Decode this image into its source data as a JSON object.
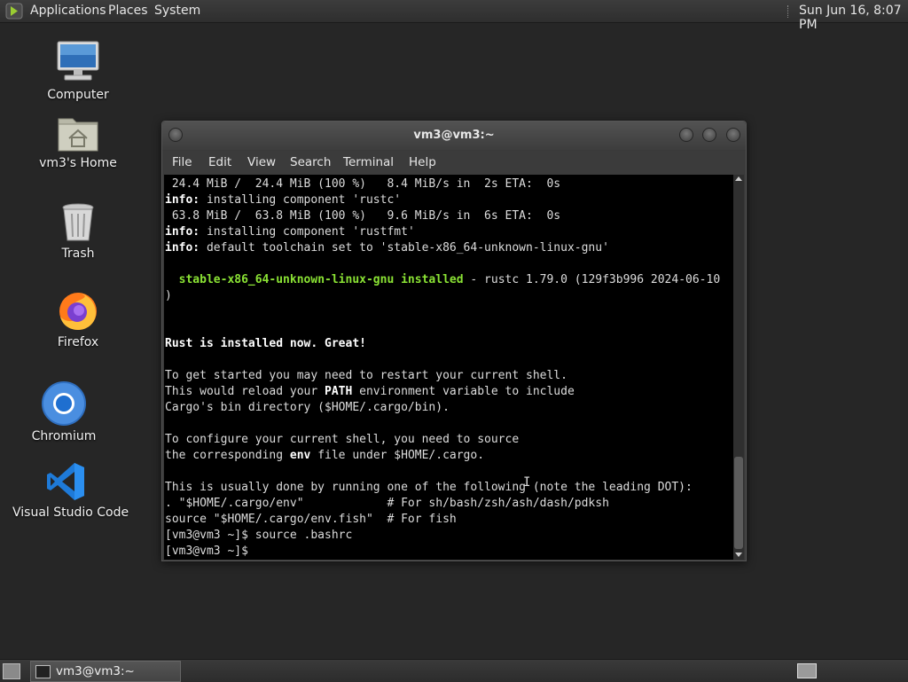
{
  "top_panel": {
    "menus": [
      "Applications",
      "Places",
      "System"
    ],
    "clock": "Sun Jun 16,  8:07 PM"
  },
  "desktop_icons": [
    {
      "label": "Computer",
      "icon": "computer-icon"
    },
    {
      "label": "vm3's Home",
      "icon": "home-folder-icon"
    },
    {
      "label": "Trash",
      "icon": "trash-icon"
    },
    {
      "label": "Firefox",
      "icon": "firefox-icon"
    },
    {
      "label": "Chromium",
      "icon": "chromium-icon"
    },
    {
      "label": "Visual Studio Code",
      "icon": "vscode-icon"
    }
  ],
  "terminal": {
    "title": "vm3@vm3:~",
    "menu": [
      "File",
      "Edit",
      "View",
      "Search",
      "Terminal",
      "Help"
    ],
    "lines": [
      [
        {
          "t": " 24.4 MiB /  24.4 MiB (100 %)   8.4 MiB/s in  2s ETA:  0s"
        }
      ],
      [
        {
          "t": "info:",
          "b": 1
        },
        {
          "t": " installing component 'rustc'"
        }
      ],
      [
        {
          "t": " 63.8 MiB /  63.8 MiB (100 %)   9.6 MiB/s in  6s ETA:  0s"
        }
      ],
      [
        {
          "t": "info:",
          "b": 1
        },
        {
          "t": " installing component 'rustfmt'"
        }
      ],
      [
        {
          "t": "info:",
          "b": 1
        },
        {
          "t": " default toolchain set to 'stable-x86_64-unknown-linux-gnu'"
        }
      ],
      [
        {
          "t": ""
        }
      ],
      [
        {
          "t": "  "
        },
        {
          "t": "stable-x86_64-unknown-linux-gnu installed",
          "g": 1
        },
        {
          "t": " - rustc 1.79.0 (129f3b996 2024-06-10"
        }
      ],
      [
        {
          "t": ")"
        }
      ],
      [
        {
          "t": ""
        }
      ],
      [
        {
          "t": ""
        }
      ],
      [
        {
          "t": "Rust is installed now. Great!",
          "b": 1
        }
      ],
      [
        {
          "t": ""
        }
      ],
      [
        {
          "t": "To get started you may need to restart your current shell."
        }
      ],
      [
        {
          "t": "This would reload your "
        },
        {
          "t": "PATH",
          "b": 1
        },
        {
          "t": " environment variable to include"
        }
      ],
      [
        {
          "t": "Cargo's bin directory ($HOME/.cargo/bin)."
        }
      ],
      [
        {
          "t": ""
        }
      ],
      [
        {
          "t": "To configure your current shell, you need to source"
        }
      ],
      [
        {
          "t": "the corresponding "
        },
        {
          "t": "env",
          "b": 1
        },
        {
          "t": " file under $HOME/.cargo."
        }
      ],
      [
        {
          "t": ""
        }
      ],
      [
        {
          "t": "This is usually done by running one of the following (note the leading DOT):"
        }
      ],
      [
        {
          "t": ". \"$HOME/.cargo/env\"            # For sh/bash/zsh/ash/dash/pdksh"
        }
      ],
      [
        {
          "t": "source \"$HOME/.cargo/env.fish\"  # For fish"
        }
      ],
      [
        {
          "t": "[vm3@vm3 ~]$ source .bashrc"
        }
      ],
      [
        {
          "t": "[vm3@vm3 ~]$ "
        }
      ]
    ]
  },
  "taskbar": {
    "task_label": "vm3@vm3:~"
  }
}
